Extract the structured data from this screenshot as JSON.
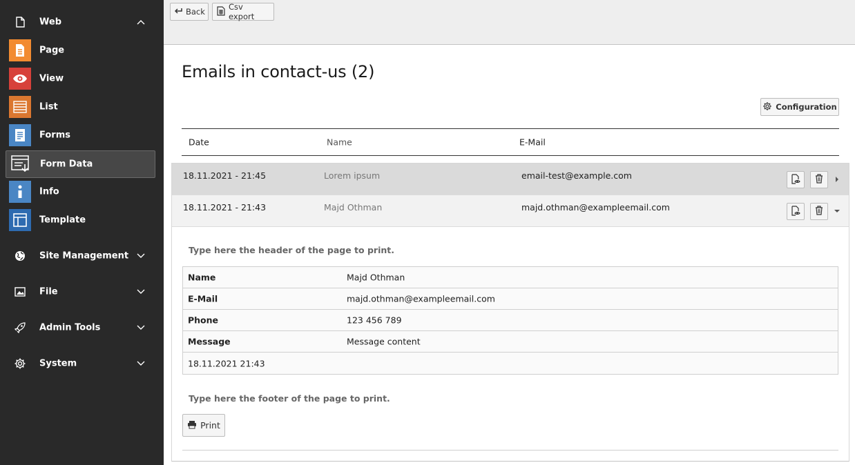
{
  "sidebar": {
    "web": {
      "label": "Web"
    },
    "modules": [
      {
        "label": "Page",
        "icon": "page-icon",
        "color": "#f28b31"
      },
      {
        "label": "View",
        "icon": "eye-icon",
        "color": "#d7413a"
      },
      {
        "label": "List",
        "icon": "list-icon",
        "color": "#db7730"
      },
      {
        "label": "Forms",
        "icon": "forms-icon",
        "color": "#4a86c4"
      },
      {
        "label": "Form Data",
        "icon": "form-data-icon",
        "color": "#474747"
      },
      {
        "label": "Info",
        "icon": "info-icon",
        "color": "#4a86c4"
      },
      {
        "label": "Template",
        "icon": "template-icon",
        "color": "#2e6bb0"
      }
    ],
    "groups": [
      {
        "label": "Site Management",
        "icon": "globe-icon"
      },
      {
        "label": "File",
        "icon": "image-icon"
      },
      {
        "label": "Admin Tools",
        "icon": "rocket-icon"
      },
      {
        "label": "System",
        "icon": "gear-icon"
      }
    ]
  },
  "toolbar": {
    "back_label": "Back",
    "csv_label": "Csv export"
  },
  "main": {
    "title": "Emails in contact-us (2)",
    "configuration_label": "Configuration",
    "columns": [
      "Date",
      "Name",
      "E-Mail"
    ],
    "rows": [
      {
        "date": "18.11.2021 - 21:45",
        "name": "Lorem ipsum",
        "email": "email-test@example.com"
      },
      {
        "date": "18.11.2021 - 21:43",
        "name": "Majd Othman",
        "email": "majd.othman@exampleemail.com"
      }
    ],
    "detail": {
      "header_text": "Type here the header of the page to print.",
      "fields": [
        {
          "key": "Name",
          "value": "Majd Othman"
        },
        {
          "key": "E-Mail",
          "value": "majd.othman@exampleemail.com"
        },
        {
          "key": "Phone",
          "value": "123 456 789"
        },
        {
          "key": "Message",
          "value": "Message content"
        }
      ],
      "timestamp": "18.11.2021 21:43",
      "footer_text": "Type here the footer of the page to print.",
      "print_label": "Print"
    }
  }
}
